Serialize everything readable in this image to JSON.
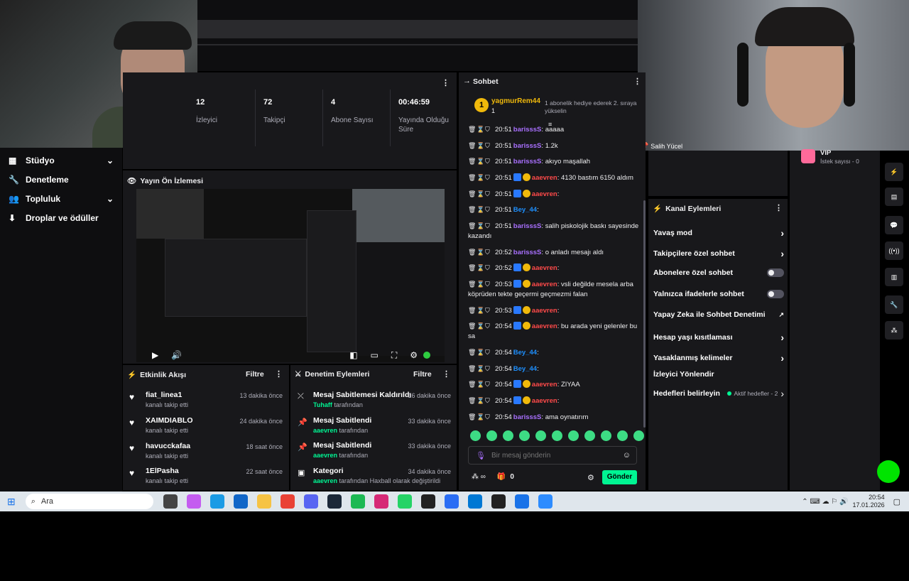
{
  "colors": {
    "accent": "#a970ff",
    "go": "#00f593",
    "panel": "#18181b",
    "bg": "#0e0e10"
  },
  "sidebar": {
    "items": [
      {
        "label": "Stüdyo",
        "icon": "studio-icon",
        "chev": true
      },
      {
        "label": "Denetleme",
        "icon": "wrench-icon",
        "chev": false
      },
      {
        "label": "Topluluk",
        "icon": "community-icon",
        "chev": true
      },
      {
        "label": "Droplar ve ödüller",
        "icon": "drops-icon",
        "chev": false
      }
    ]
  },
  "stats": [
    {
      "value": "12",
      "label": "İzleyici"
    },
    {
      "value": "72",
      "label": "Takipçi"
    },
    {
      "value": "4",
      "label": "Abone Sayısı"
    },
    {
      "value": "00:46:59",
      "label": "Yayında Olduğu Süre"
    }
  ],
  "preview": {
    "title": "Yayın Ön İzlemesi"
  },
  "webcam_label": "Salih Yücel",
  "chat": {
    "title": "Sohbet",
    "pinned_user": "yagmurRem44",
    "pinned_count": "1",
    "pinned_msg": "1 abonelik hediye ederek 2. sıraya yükselin",
    "lines": [
      {
        "time": "20:51",
        "user": "barisssS",
        "cls": "u-purple",
        "msg": "aaaaa",
        "badges": []
      },
      {
        "time": "20:51",
        "user": "barisssS",
        "cls": "u-purple",
        "msg": "1.2k",
        "badges": []
      },
      {
        "time": "20:51",
        "user": "barisssS",
        "cls": "u-purple",
        "msg": "akıyo maşallah",
        "badges": []
      },
      {
        "time": "20:51",
        "user": "aaevren",
        "cls": "u-red",
        "msg": "4130 bastım 6150 aldım",
        "badges": [
          "blue",
          "gold"
        ]
      },
      {
        "time": "20:51",
        "user": "aaevren",
        "cls": "u-red",
        "msg": "",
        "badges": [
          "blue",
          "gold"
        ]
      },
      {
        "time": "20:51",
        "user": "Bey_44",
        "cls": "u-blue",
        "msg": "",
        "badges": []
      },
      {
        "time": "20:51",
        "user": "barisssS",
        "cls": "u-purple",
        "msg": "salih piskolojik baskı sayesinde kazandı",
        "badges": []
      },
      {
        "time": "20:52",
        "user": "barisssS",
        "cls": "u-purple",
        "msg": "o anladı mesajı aldı",
        "badges": []
      },
      {
        "time": "20:52",
        "user": "aaevren",
        "cls": "u-red",
        "msg": "",
        "badges": [
          "blue",
          "gold"
        ]
      },
      {
        "time": "20:53",
        "user": "aaevren",
        "cls": "u-red",
        "msg": "vsli değilde mesela arba köprüden tekte geçermi geçmezmi falan",
        "badges": [
          "blue",
          "gold"
        ]
      },
      {
        "time": "20:53",
        "user": "aaevren",
        "cls": "u-red",
        "msg": "",
        "badges": [
          "blue",
          "gold"
        ]
      },
      {
        "time": "20:54",
        "user": "aaevren",
        "cls": "u-red",
        "msg": "bu arada yeni gelenler bu sa",
        "badges": [
          "blue",
          "gold"
        ]
      },
      {
        "time": "20:54",
        "user": "Bey_44",
        "cls": "u-blue",
        "msg": "",
        "badges": []
      },
      {
        "time": "20:54",
        "user": "Bey_44",
        "cls": "u-blue",
        "msg": "",
        "badges": []
      },
      {
        "time": "20:54",
        "user": "aaevren",
        "cls": "u-red",
        "msg": "ZIYAA",
        "badges": [
          "blue",
          "gold"
        ]
      },
      {
        "time": "20:54",
        "user": "aaevren",
        "cls": "u-red",
        "msg": "",
        "badges": [
          "blue",
          "gold"
        ]
      },
      {
        "time": "20:54",
        "user": "barisssS",
        "cls": "u-purple",
        "msg": "ama oynatırım",
        "badges": []
      }
    ],
    "input_placeholder": "Bir mesaj gönderin",
    "points": "0",
    "send_label": "Gönder"
  },
  "activity": {
    "title": "Etkinlik Akışı",
    "filter": "Filtre",
    "items": [
      {
        "name": "fiat_linea1",
        "sub": "kanalı takip etti",
        "time": "13 dakika önce"
      },
      {
        "name": "XAIMDIABLO",
        "sub": "kanalı takip etti",
        "time": "24 dakika önce"
      },
      {
        "name": "havucckafaa",
        "sub": "kanalı takip etti",
        "time": "18 saat önce"
      },
      {
        "name": "1ElPasha",
        "sub": "kanalı takip etti",
        "time": "22 saat önce"
      }
    ]
  },
  "modlog": {
    "title": "Denetim Eylemleri",
    "filter": "Filtre",
    "items": [
      {
        "name": "Mesaj Sabitlemesi Kaldırıldı",
        "by": "Tuhaff",
        "rest": "tarafından",
        "time": "16 dakika önce"
      },
      {
        "name": "Mesaj Sabitlendi",
        "by": "aaevren",
        "rest": "tarafından",
        "time": "33 dakika önce"
      },
      {
        "name": "Mesaj Sabitlendi",
        "by": "aaevren",
        "rest": "tarafından",
        "time": "33 dakika önce"
      },
      {
        "name": "Kategori",
        "by": "aaevren",
        "rest": "tarafından Haxball olarak değiştirildi",
        "time": "34 dakika önce"
      }
    ]
  },
  "vip": {
    "title": "VIP",
    "sub": "İstek sayısı - 0"
  },
  "actions": {
    "title": "Kanal Eylemleri",
    "items": [
      {
        "label": "Yavaş mod",
        "ctrl": "chev"
      },
      {
        "label": "Takipçilere özel sohbet",
        "ctrl": "chev"
      },
      {
        "label": "Abonelere özel sohbet",
        "ctrl": "toggle"
      },
      {
        "label": "Yalnızca ifadelerle sohbet",
        "ctrl": "toggle"
      },
      {
        "label": "Yapay Zeka ile Sohbet Denetimi",
        "ctrl": "ext"
      },
      {
        "label": "Hesap yaşı kısıtlaması",
        "ctrl": "chev"
      },
      {
        "label": "Yasaklanmış kelimeler",
        "ctrl": "chev"
      },
      {
        "label": "İzleyici Yönlendir",
        "ctrl": "none"
      },
      {
        "label": "Hedefleri belirleyin",
        "ctrl": "goals"
      }
    ],
    "goals_text": "Aktif hedefler - 2"
  },
  "taskbar": {
    "search": "Ara",
    "time": "20:54",
    "date": "17.01.2026"
  }
}
